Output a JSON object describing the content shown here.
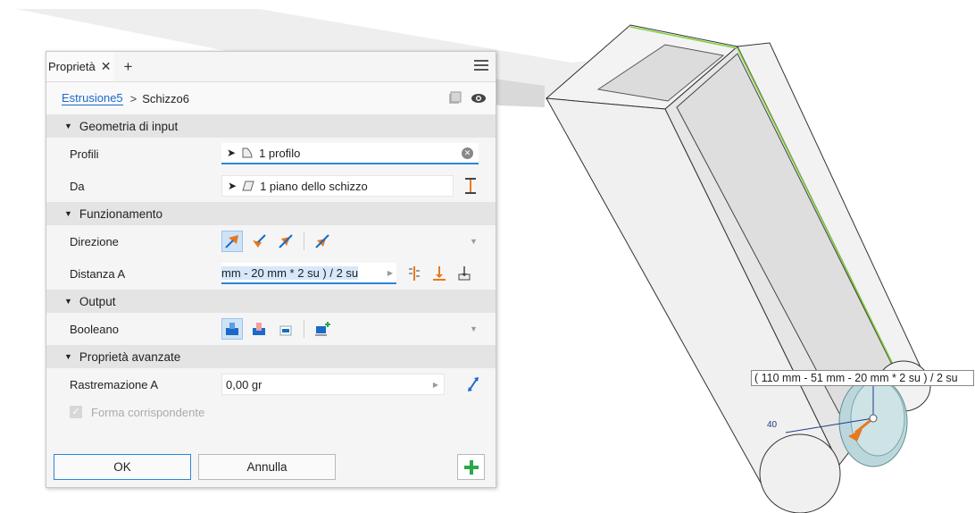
{
  "panel": {
    "tab_label": "Proprietà",
    "breadcrumb": {
      "parent": "Estrusione5",
      "current": "Schizzo6"
    },
    "sections": {
      "input": "Geometria di input",
      "behavior": "Funzionamento",
      "output": "Output",
      "advanced": "Proprietà avanzate"
    },
    "rows": {
      "profiles_label": "Profili",
      "profiles_value": "1 profilo",
      "from_label": "Da",
      "from_value": "1 piano dello schizzo",
      "direction_label": "Direzione",
      "distance_label": "Distanza A",
      "distance_value": "mm - 20 mm * 2 su ) / 2 su",
      "boolean_label": "Booleano",
      "taper_label": "Rastremazione A",
      "taper_value": "0,00 gr",
      "match_shape_label": "Forma corrispondente"
    },
    "footer": {
      "ok": "OK",
      "cancel": "Annulla"
    }
  },
  "viewport": {
    "dimension_label": "( 110 mm - 51 mm - 20 mm * 2 su ) / 2 su",
    "small_dimension": "40"
  },
  "colors": {
    "accent": "#1b6ac9",
    "selection": "#cfe3f7",
    "edge_highlight": "#7fd13b",
    "arrow": "#e8781e",
    "add": "#2aa84a"
  }
}
